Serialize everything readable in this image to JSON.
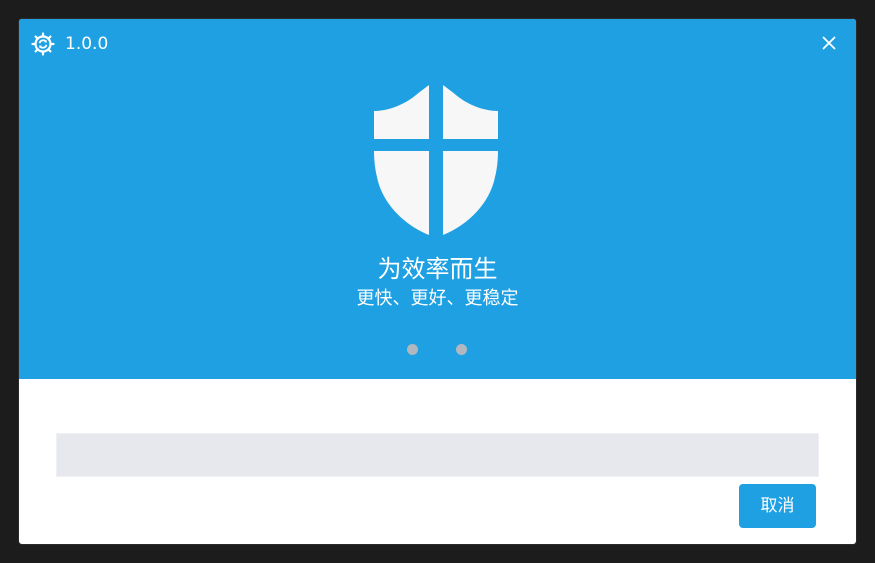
{
  "window": {
    "version": "1.0.0",
    "app_icon": "gear-refresh-icon",
    "close_icon": "close-icon"
  },
  "banner": {
    "icon": "shield-icon",
    "title": "为效率而生",
    "subtitle": "更快、更好、更稳定",
    "carousel": {
      "page_count": 2
    }
  },
  "progress": {
    "value": 0
  },
  "actions": {
    "cancel_label": "取消"
  },
  "colors": {
    "accent": "#1ea0e2",
    "progress_track": "#e6e8ee",
    "dot": "#b0b7bf",
    "text_on_accent": "#ffffff",
    "background": "#1c1c1c"
  }
}
